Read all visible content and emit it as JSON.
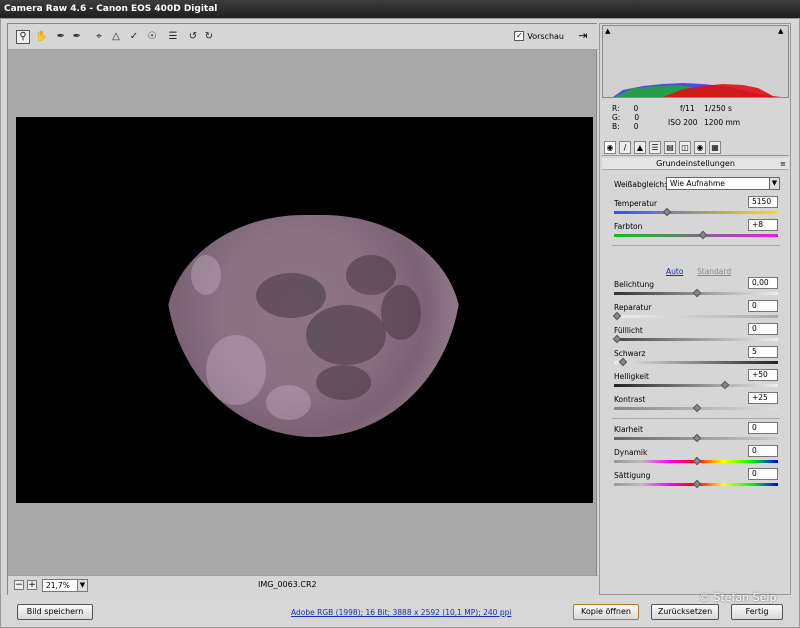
{
  "window": {
    "title": "Camera Raw 4.6 - Canon EOS 400D Digital"
  },
  "toolbar": {
    "tools": [
      "zoom-icon",
      "hand-icon",
      "white-balance-icon",
      "color-sampler-icon",
      "crop-icon",
      "straighten-icon",
      "spot-removal-icon",
      "red-eye-icon",
      "preferences-icon",
      "rotate-left-icon",
      "rotate-right-icon"
    ],
    "preview_label": "Vorschau",
    "preview_checked": true
  },
  "canvas": {
    "filename": "IMG_0063.CR2"
  },
  "zoom": {
    "minus": "−",
    "plus": "+",
    "value": "21,7%"
  },
  "histogram": {
    "description_colors": [
      "#0000ff",
      "#00c000",
      "#ff0000"
    ]
  },
  "readout": {
    "r_label": "R:",
    "r_value": "0",
    "g_label": "G:",
    "g_value": "0",
    "b_label": "B:",
    "b_value": "0",
    "aperture": "f/11",
    "shutter": "1/250 s",
    "iso": "ISO 200",
    "focal": "1200 mm"
  },
  "panel": {
    "title": "Grundeinstellungen",
    "wb_label": "Weißabgleich:",
    "wb_value": "Wie Aufnahme",
    "auto_label": "Auto",
    "standard_label": "Standard",
    "sliders": [
      {
        "label": "Temperatur",
        "value": "5150"
      },
      {
        "label": "Farbton",
        "value": "+8"
      },
      {
        "label": "Belichtung",
        "value": "0,00"
      },
      {
        "label": "Reparatur",
        "value": "0"
      },
      {
        "label": "Fülllicht",
        "value": "0"
      },
      {
        "label": "Schwarz",
        "value": "5"
      },
      {
        "label": "Helligkeit",
        "value": "+50"
      },
      {
        "label": "Kontrast",
        "value": "+25"
      },
      {
        "label": "Klarheit",
        "value": "0"
      },
      {
        "label": "Dynamik",
        "value": "0"
      },
      {
        "label": "Sättigung",
        "value": "0"
      }
    ]
  },
  "bottom": {
    "save_label": "Bild speichern",
    "info_link": "Adobe RGB (1998); 16 Bit; 3888 x 2592 (10,1 MP); 240 ppi",
    "open_copy_label": "Kopie öffnen",
    "reset_label": "Zurücksetzen",
    "done_label": "Fertig"
  },
  "watermark": "© Stefan Seip"
}
